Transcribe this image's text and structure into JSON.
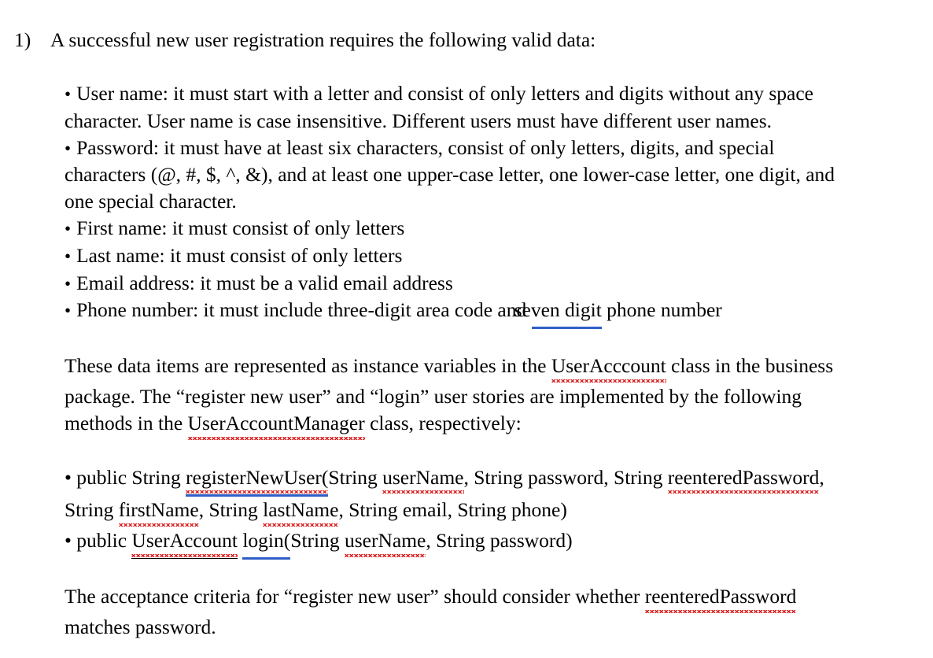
{
  "document": {
    "item_number": "1)",
    "intro": "A successful new user registration requires the following valid data:",
    "bullet_marker": "•",
    "requirements": [
      {
        "label": "username",
        "lines": [
          "User name: it must start with a letter and consist of only letters and digits without any space",
          "character. User name is case insensitive. Different users must have different user names."
        ]
      },
      {
        "label": "password",
        "lines": [
          "Password: it must have at least six characters, consist of only letters, digits, and special",
          "characters (@, #, $, ^, &), and at least one upper-case letter, one lower-case letter, one digit, and",
          "one special character."
        ]
      },
      {
        "label": "first-name",
        "lines": [
          "First name: it must consist of only letters"
        ]
      },
      {
        "label": "last-name",
        "lines": [
          "Last name: it must consist of only letters"
        ]
      },
      {
        "label": "email-address",
        "lines": [
          "Email address: it must be a valid email address"
        ]
      }
    ],
    "phone_bullet": {
      "label": "phone-number",
      "before": "Phone number: it must include three-digit area code and ",
      "grammar_flagged": "seven digit",
      "after": " phone number"
    },
    "paragraph_instance_vars": {
      "line1_before": "These data items are represented as instance variables in the ",
      "line1_spelled": "UserAcccount",
      "line1_after": " class in the business",
      "line2": "package. The “register new user” and “login” user stories are implemented by the following",
      "line3_before": "methods in the ",
      "line3_spelled": "UserAccountManager",
      "line3_after": " class, respectively:"
    },
    "methods": [
      {
        "label": "register-new-user",
        "line1": [
          {
            "t": "• public String ",
            "style": "plain"
          },
          {
            "t": "registerNewUser(",
            "style": "grammar-spell"
          },
          {
            "t": "String ",
            "style": "plain"
          },
          {
            "t": "userName",
            "style": "spell"
          },
          {
            "t": ", String password, String ",
            "style": "plain"
          },
          {
            "t": "reenteredPassword",
            "style": "spell"
          },
          {
            "t": ",",
            "style": "plain"
          }
        ],
        "line2": [
          {
            "t": "String ",
            "style": "plain"
          },
          {
            "t": "firstName",
            "style": "spell"
          },
          {
            "t": ", String ",
            "style": "plain"
          },
          {
            "t": "lastName",
            "style": "spell"
          },
          {
            "t": ", String email, String phone)",
            "style": "plain"
          }
        ]
      },
      {
        "label": "login",
        "line1": [
          {
            "t": "• public ",
            "style": "plain"
          },
          {
            "t": "UserAccount",
            "style": "spell-u"
          },
          {
            "t": " ",
            "style": "plain"
          },
          {
            "t": "login(",
            "style": "grammar"
          },
          {
            "t": "String ",
            "style": "plain"
          },
          {
            "t": "userName",
            "style": "spell"
          },
          {
            "t": ", String password)",
            "style": "plain"
          }
        ],
        "line2": null
      }
    ],
    "acceptance": {
      "line1_before": "The acceptance criteria for “register new user” should consider whether ",
      "line1_spelled": "reenteredPassword",
      "line2": "matches password."
    }
  },
  "colors": {
    "text": "#000000",
    "page_background": "#ffffff",
    "spelling_error": "#d81f1f",
    "grammar_error": "#2f5fc9"
  }
}
